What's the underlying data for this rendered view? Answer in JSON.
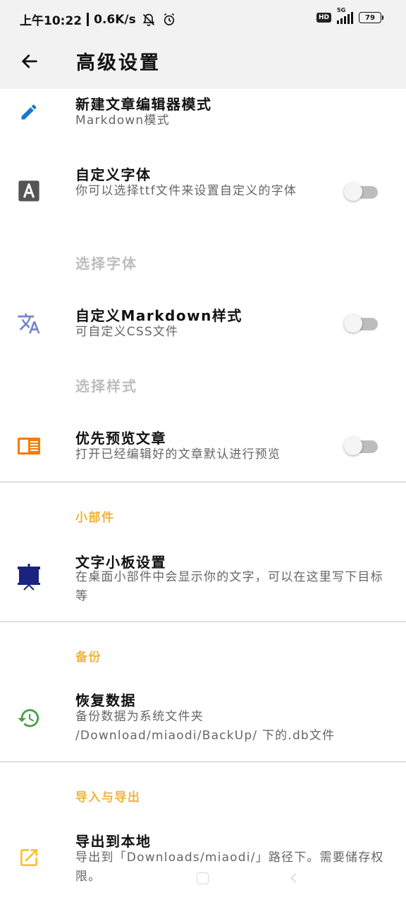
{
  "status_bar": {
    "time": "上午10:22",
    "net_speed": "0.6K/s",
    "hd_badge": "HD",
    "network_type": "5G",
    "battery_level": "79"
  },
  "app_bar": {
    "title": "高级设置"
  },
  "items": {
    "editor_mode": {
      "title": "新建文章编辑器模式",
      "summary": "Markdown模式",
      "icon": "pencil-icon"
    },
    "custom_font": {
      "title": "自定义字体",
      "summary": "你可以选择ttf文件来设置自定义的字体",
      "icon": "font-a-icon",
      "enabled": false
    },
    "choose_font": {
      "label": "选择字体"
    },
    "custom_markdown_style": {
      "title": "自定义Markdown样式",
      "summary": "可自定义CSS文件",
      "icon": "translate-icon",
      "enabled": false
    },
    "choose_style": {
      "label": "选择样式"
    },
    "preview_first": {
      "title": "优先预览文章",
      "summary": "打开已经编辑好的文章默认进行预览",
      "icon": "article-preview-icon",
      "enabled": false
    },
    "widget_text": {
      "title": "文字小板设置",
      "summary": "在桌面小部件中会显示你的文字，可以在这里写下目标等",
      "icon": "presentation-board-icon"
    },
    "restore_data": {
      "title": "恢复数据",
      "summary": "备份数据为系统文件夹 /Download/miaodi/BackUp/ 下的.db文件",
      "icon": "restore-history-icon"
    },
    "export_local": {
      "title": "导出到本地",
      "summary": "导出到「Downloads/miaodi/」路径下。需要储存权限。",
      "icon": "open-external-icon"
    }
  },
  "sections": {
    "widget": "小部件",
    "backup": "备份",
    "import_export": "导入与导出"
  },
  "colors": {
    "section_header": "#f0b43c",
    "pencil": "#1976d2",
    "translate": "#7986cb",
    "preview": "#f57c00",
    "board": "#1a237e",
    "restore": "#43a047",
    "export": "#fbc02d"
  }
}
